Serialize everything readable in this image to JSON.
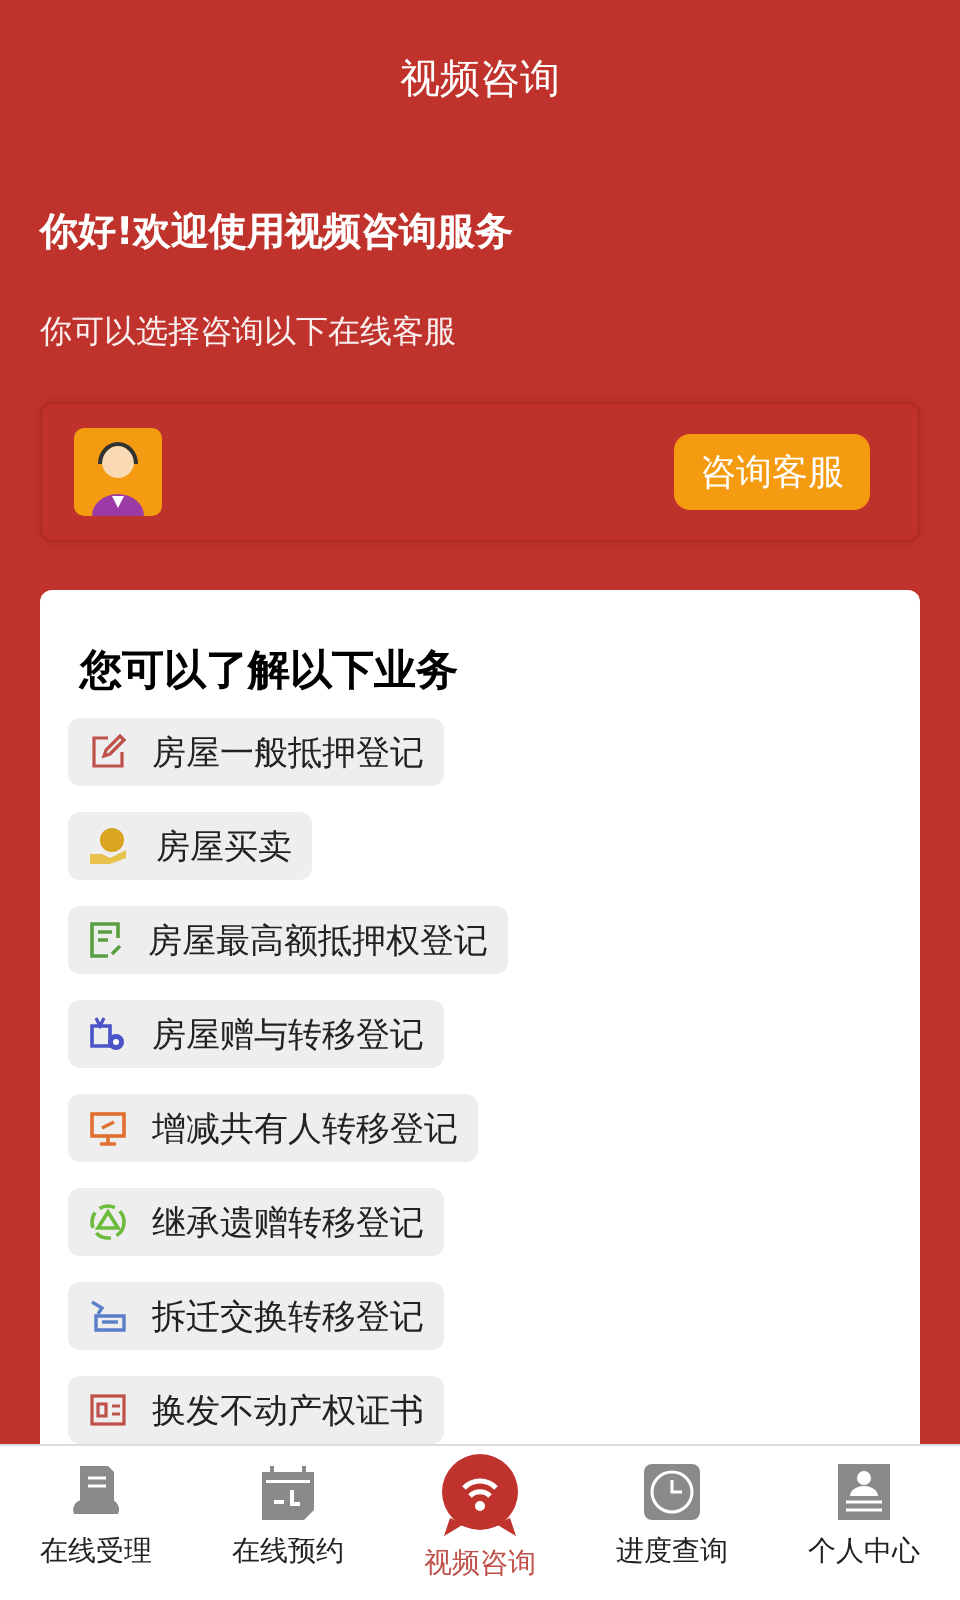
{
  "header": {
    "title": "视频咨询"
  },
  "greeting": {
    "title": "你好!欢迎使用视频咨询服务",
    "subtitle": "你可以选择咨询以下在线客服"
  },
  "agent": {
    "button": "咨询客服"
  },
  "services": {
    "title": "您可以了解以下业务",
    "items": [
      {
        "kind": "edit",
        "label": "房屋一般抵押登记"
      },
      {
        "kind": "coin",
        "label": "房屋买卖"
      },
      {
        "kind": "note",
        "label": "房屋最高额抵押权登记"
      },
      {
        "kind": "gift",
        "label": "房屋赠与转移登记"
      },
      {
        "kind": "screen",
        "label": "增减共有人转移登记"
      },
      {
        "kind": "cycle",
        "label": "继承遗赠转移登记"
      },
      {
        "kind": "move",
        "label": "拆迁交换转移登记"
      },
      {
        "kind": "card",
        "label": "换发不动产权证书"
      }
    ]
  },
  "tabs": [
    {
      "kind": "doc",
      "label": "在线受理",
      "selected": false
    },
    {
      "kind": "calendar",
      "label": "在线预约",
      "selected": false
    },
    {
      "kind": "chat",
      "label": "视频咨询",
      "selected": true
    },
    {
      "kind": "clock",
      "label": "进度查询",
      "selected": false
    },
    {
      "kind": "person",
      "label": "个人中心",
      "selected": false
    }
  ]
}
